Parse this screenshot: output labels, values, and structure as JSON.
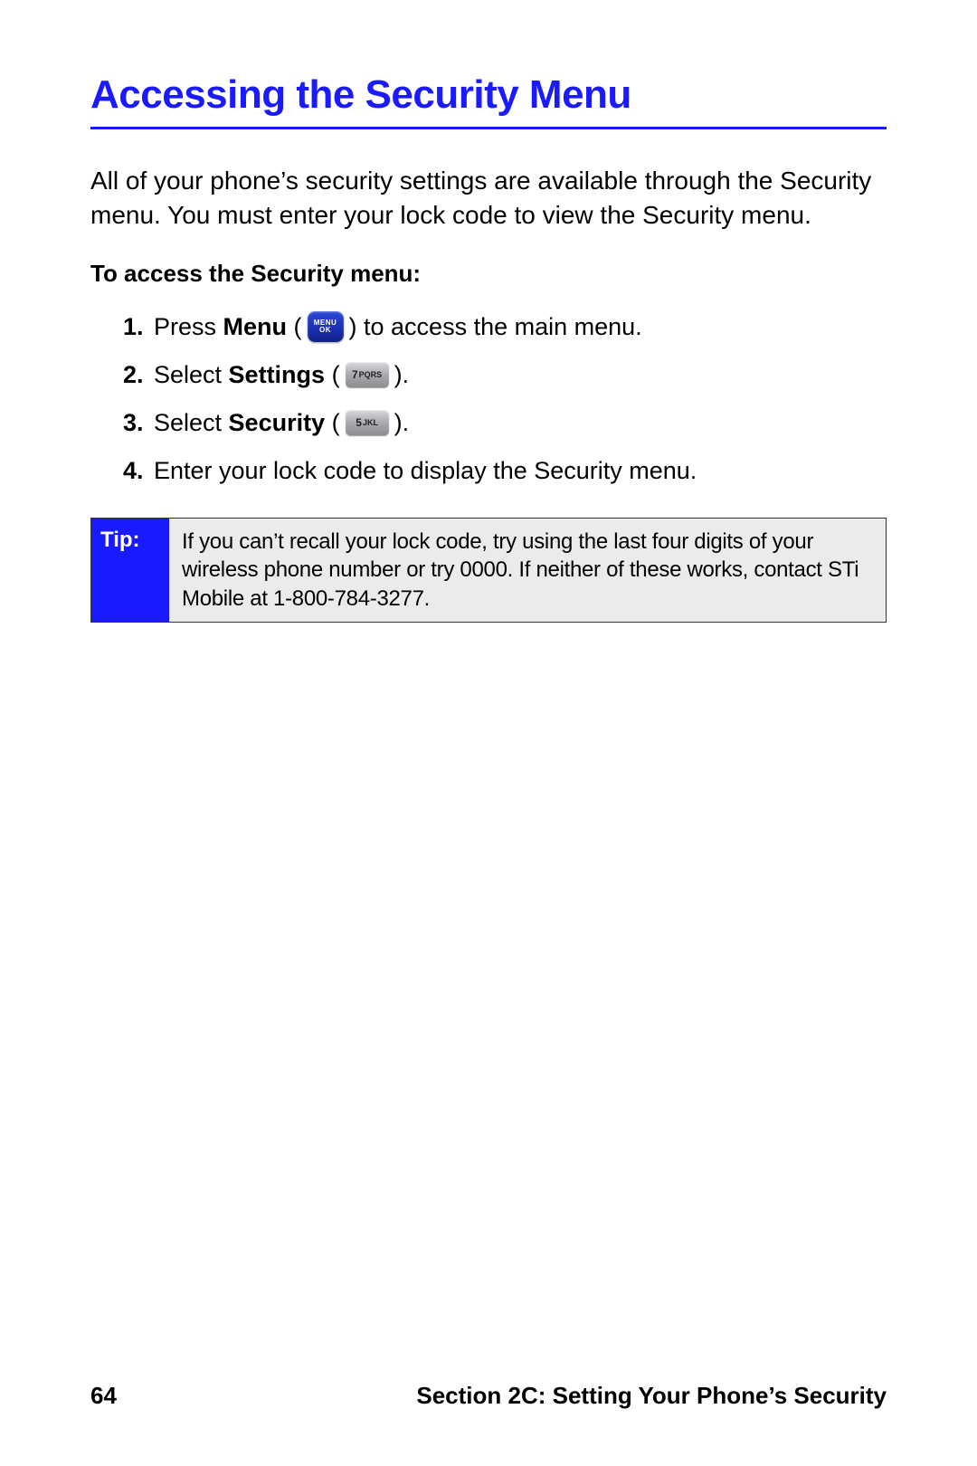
{
  "title": "Accessing the Security Menu",
  "intro": "All of your phone’s security settings are available through the Security menu. You must enter your lock code to view the Security menu.",
  "sub_heading": "To access the Security menu:",
  "steps": [
    {
      "num": "1.",
      "pre": "Press ",
      "bold": "Menu",
      "post": " (",
      "icon": "menu",
      "after": ") to access the main menu."
    },
    {
      "num": "2.",
      "pre": "Select ",
      "bold": "Settings",
      "post": " (",
      "icon": "7",
      "after": ")."
    },
    {
      "num": "3.",
      "pre": "Select ",
      "bold": "Security",
      "post": " (",
      "icon": "5",
      "after": ")."
    },
    {
      "num": "4.",
      "pre": "Enter your lock code to display the Security menu.",
      "bold": "",
      "post": "",
      "icon": "",
      "after": ""
    }
  ],
  "key_labels": {
    "menu_line1": "MENU",
    "menu_line2": "OK",
    "key7_digit": "7",
    "key7_letters": "PQRS",
    "key5_digit": "5",
    "key5_letters": "JKL"
  },
  "tip": {
    "label": "Tip:",
    "body": "If you can’t recall your lock code, try using the last four digits of your wireless phone number or try 0000. If neither of these works, contact STi Mobile at 1-800-784-3277."
  },
  "footer": {
    "page": "64",
    "section": "Section 2C: Setting Your Phone’s Security"
  }
}
